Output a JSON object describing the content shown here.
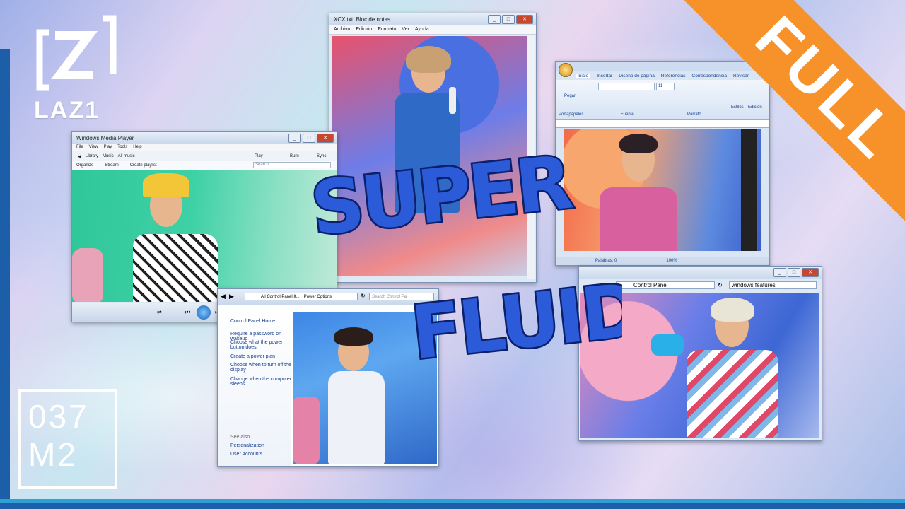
{
  "brand": {
    "name": "LAZ1",
    "colors": {
      "accent": "#f7922a",
      "navy": "#1c5fa8"
    }
  },
  "episode": {
    "line1": "037",
    "line2": "M2"
  },
  "banner": {
    "label": "FULL"
  },
  "title": {
    "line1": "SUPER",
    "line2": "FLUID"
  },
  "notepad": {
    "title": "XCX.txt: Bloc de notas",
    "menu": [
      "Archivo",
      "Edición",
      "Formato",
      "Ver",
      "Ayuda"
    ]
  },
  "wmp": {
    "title": "Windows Media Player",
    "menu": [
      "File",
      "View",
      "Play",
      "Tools",
      "Help"
    ],
    "breadcrumb": [
      "Library",
      "Music",
      "All music"
    ],
    "tabs": [
      "Play",
      "Burn",
      "Sync"
    ],
    "toolbar": [
      "Organize",
      "Stream",
      "Create playlist"
    ],
    "search_placeholder": "Search"
  },
  "word": {
    "tabs": [
      "Inicio",
      "Insertar",
      "Diseño de página",
      "Referencias",
      "Correspondencia",
      "Revisar"
    ],
    "font_size": "11",
    "groups": [
      "Portapapeles",
      "Fuente",
      "Párrafo"
    ],
    "side": [
      "Estilos",
      "Edición"
    ],
    "paste": "Pegar",
    "status": "Palabras: 0",
    "zoom": "100%"
  },
  "control_panel": {
    "address": "Control Panel",
    "search_value": "windows features"
  },
  "power_options": {
    "address": [
      "All Control Panel It...",
      "Power Options"
    ],
    "search_placeholder": "Search Control Pa",
    "home": "Control Panel Home",
    "links": [
      "Require a password on wakeup",
      "Choose what the power button does",
      "Create a power plan",
      "Choose when to turn off the display",
      "Change when the computer sleeps"
    ],
    "see_also": "See also",
    "see_also_links": [
      "Personalization",
      "User Accounts"
    ]
  }
}
